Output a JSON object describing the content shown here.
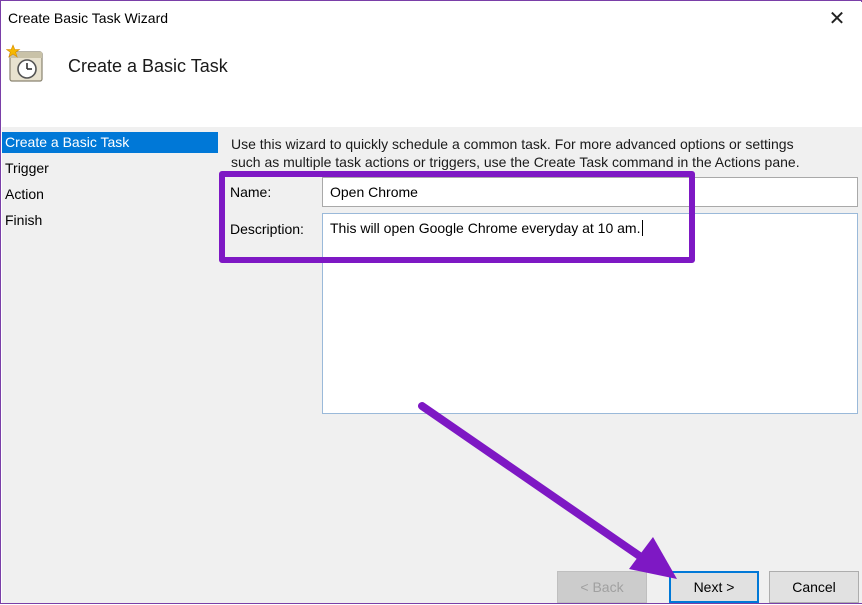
{
  "window": {
    "title": "Create Basic Task Wizard",
    "close_glyph": "✕"
  },
  "header": {
    "title": "Create a Basic Task",
    "icon": "scheduler-clock-icon"
  },
  "nav": {
    "items": [
      {
        "label": "Create a Basic Task",
        "active": true
      },
      {
        "label": "Trigger",
        "active": false
      },
      {
        "label": "Action",
        "active": false
      },
      {
        "label": "Finish",
        "active": false
      }
    ]
  },
  "main": {
    "intro_line1": "Use this wizard to quickly schedule a common task.  For more advanced options or settings",
    "intro_line2": "such as multiple task actions or triggers, use the Create Task command in the Actions pane.",
    "name_label": "Name:",
    "name_value": "Open Chrome",
    "description_label": "Description:",
    "description_value": "This will open Google Chrome everyday at 10 am."
  },
  "footer": {
    "back_label": "< Back",
    "next_label": "Next >",
    "cancel_label": "Cancel"
  },
  "colors": {
    "accent": "#0078d7",
    "annotation": "#7e18c4"
  }
}
